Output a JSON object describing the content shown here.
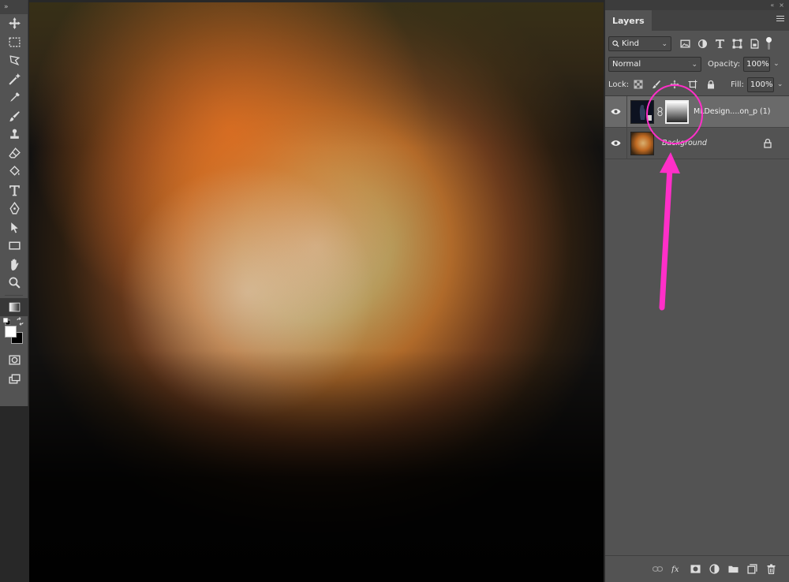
{
  "toolbar": {
    "tools": [
      "move-icon",
      "marquee-icon",
      "lasso-icon",
      "magic-wand-icon",
      "eyedropper-icon",
      "brush-icon",
      "stamp-icon",
      "eraser-icon",
      "paint-bucket-icon",
      "type-icon",
      "pen-icon",
      "path-select-icon",
      "rectangle-icon",
      "hand-icon",
      "zoom-icon",
      "gradient-icon"
    ],
    "active_tool": "gradient-icon",
    "foreground_color": "#ffffff",
    "background_color": "#000000"
  },
  "layers_panel": {
    "tab_label": "Layers",
    "filter_kind": "Kind",
    "blend_mode": "Normal",
    "opacity_label": "Opacity:",
    "opacity_value": "100%",
    "lock_label": "Lock:",
    "fill_label": "Fill:",
    "fill_value": "100%",
    "layers": [
      {
        "name": "MLDesign....on_p (1)",
        "selected": true,
        "has_mask": true,
        "visible": true
      },
      {
        "name": "Background",
        "selected": false,
        "locked": true,
        "visible": true
      }
    ]
  },
  "annotation": {
    "color": "#ff2fc8"
  }
}
